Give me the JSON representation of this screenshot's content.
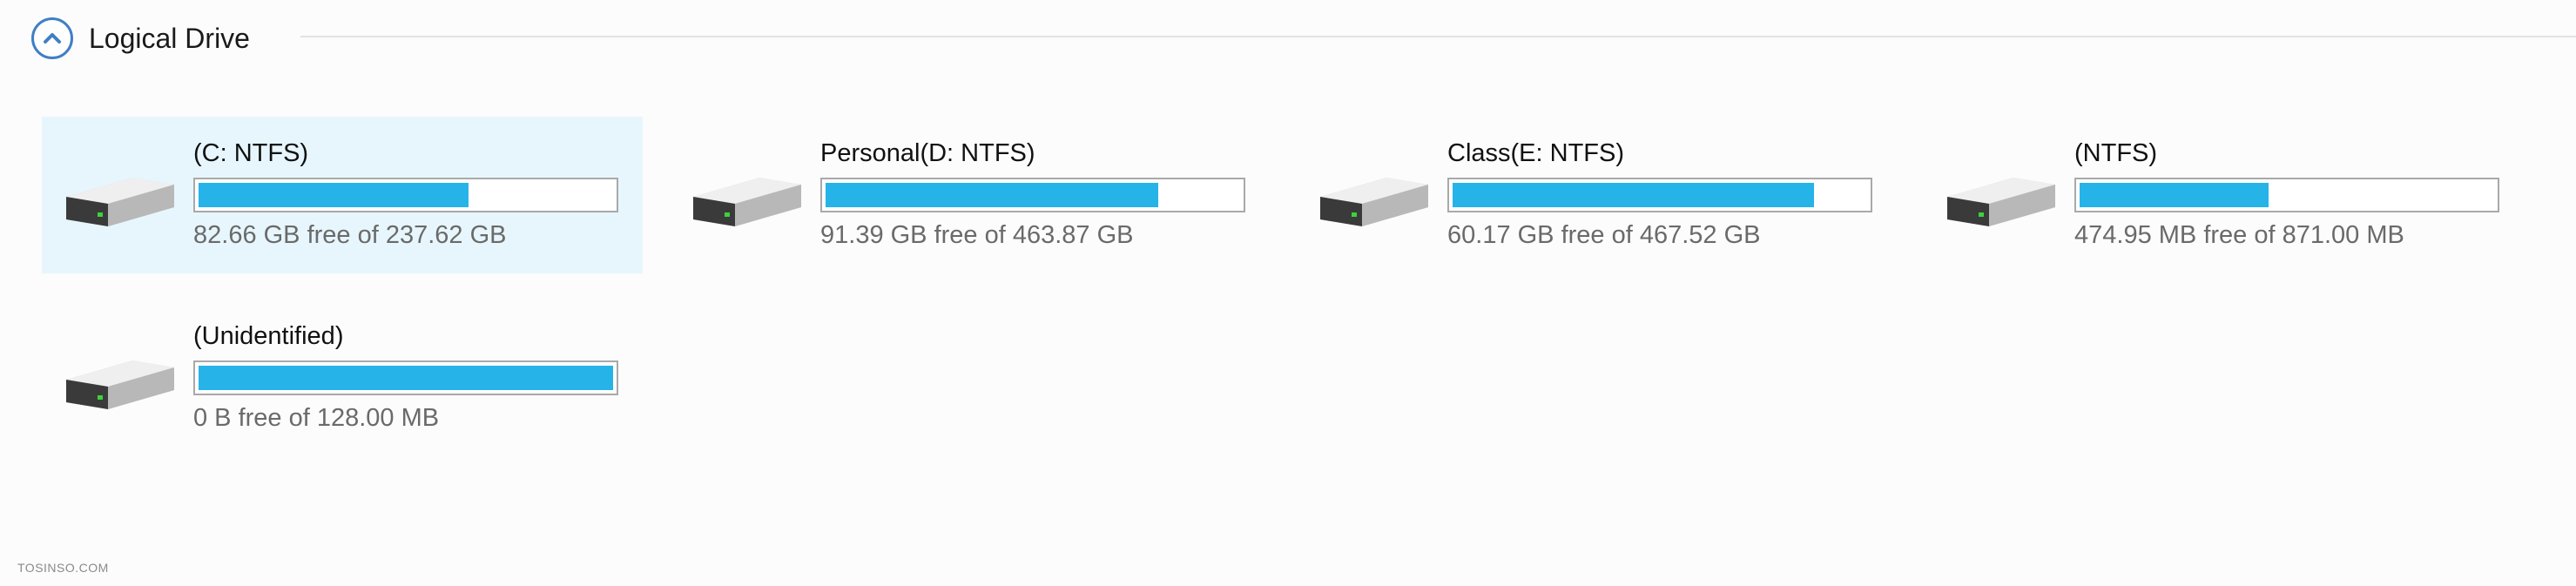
{
  "section": {
    "title": "Logical Drive",
    "collapse_icon": "chevron-up-circle-icon"
  },
  "drives": [
    {
      "name": "(C: NTFS)",
      "free_text": "82.66 GB free of 237.62 GB",
      "used_fraction": 0.652,
      "selected": true,
      "icon": "hard-drive-icon"
    },
    {
      "name": "Personal(D: NTFS)",
      "free_text": "91.39 GB free of 463.87 GB",
      "used_fraction": 0.803,
      "selected": false,
      "icon": "hard-drive-icon"
    },
    {
      "name": "Class(E: NTFS)",
      "free_text": "60.17 GB free of 467.52 GB",
      "used_fraction": 0.871,
      "selected": false,
      "icon": "hard-drive-icon"
    },
    {
      "name": "(NTFS)",
      "free_text": "474.95 MB free of 871.00 MB",
      "used_fraction": 0.455,
      "selected": false,
      "icon": "hard-drive-icon"
    },
    {
      "name": "(Unidentified)",
      "free_text": "0 B free of 128.00 MB",
      "used_fraction": 1.0,
      "selected": false,
      "icon": "hard-drive-icon"
    }
  ],
  "colors": {
    "bar_fill": "#26b3e8",
    "selected_bg": "#e7f6fd",
    "accent": "#3f7fc6"
  },
  "watermark": "TOSINSO.COM"
}
